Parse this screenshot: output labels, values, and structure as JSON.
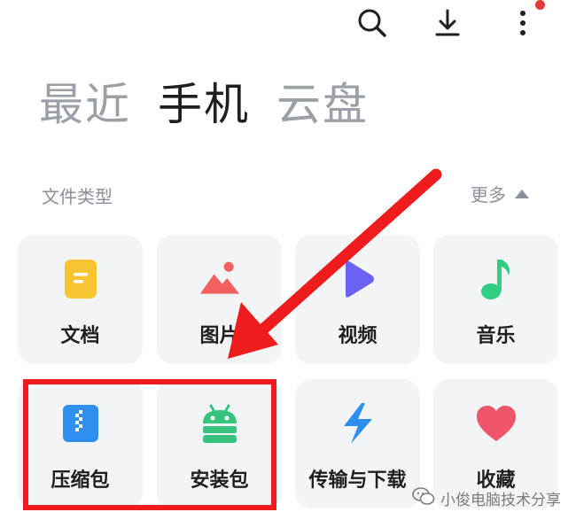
{
  "toolbar": {
    "search_icon": "search-icon",
    "download_icon": "download-icon",
    "more_icon": "more-vert-icon",
    "notification_color": "#e53935"
  },
  "tabs": [
    {
      "label": "最近",
      "active": false
    },
    {
      "label": "手机",
      "active": true
    },
    {
      "label": "云盘",
      "active": false
    }
  ],
  "file_types": {
    "title": "文件类型",
    "more_label": "更多",
    "items": [
      {
        "label": "文档",
        "icon": "document-icon",
        "color": "#f7c531"
      },
      {
        "label": "图片",
        "icon": "image-icon",
        "color": "#f26060"
      },
      {
        "label": "视频",
        "icon": "video-play-icon",
        "color": "#6c63f5"
      },
      {
        "label": "音乐",
        "icon": "music-note-icon",
        "color": "#2fcf83"
      },
      {
        "label": "压缩包",
        "icon": "zip-archive-icon",
        "color": "#2f8fef"
      },
      {
        "label": "安装包",
        "icon": "android-icon",
        "color": "#37c27e"
      },
      {
        "label": "传输与下载",
        "icon": "transfer-bolt-icon",
        "color": "#2f8fef"
      },
      {
        "label": "收藏",
        "icon": "heart-icon",
        "color": "#f0566a"
      }
    ]
  },
  "annotation": {
    "color": "#ee1c1c"
  },
  "watermark": {
    "text": "小俊电脑技术分享"
  }
}
